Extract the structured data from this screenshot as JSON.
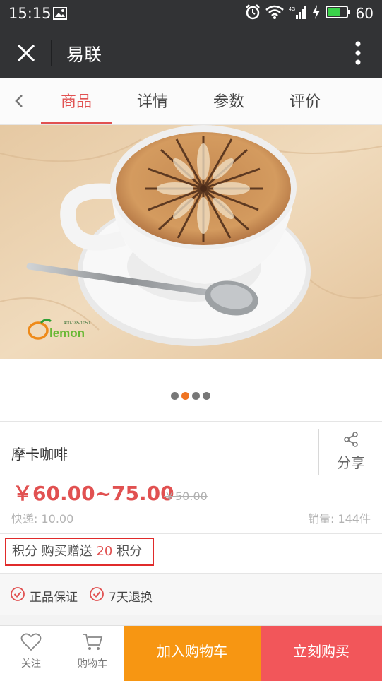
{
  "status_bar": {
    "time": "15:15",
    "battery": "60"
  },
  "title_bar": {
    "title": "易联"
  },
  "tabs": [
    {
      "label": "商品"
    },
    {
      "label": "详情"
    },
    {
      "label": "参数"
    },
    {
      "label": "评价"
    }
  ],
  "gallery": {
    "watermark_text": "lemon",
    "watermark_phone": "400-185-1050",
    "active_index": 1,
    "count": 4
  },
  "product": {
    "name": "摩卡咖啡",
    "share_label": "分享",
    "price": "￥60.00~75.00",
    "original_price": "￥50.00",
    "shipping": "快递: 10.00",
    "sales": "销量: 144件"
  },
  "points": {
    "label": "积分 购买赠送 ",
    "amount": "20",
    "suffix": " 积分"
  },
  "guarantees": [
    {
      "label": "正品保证"
    },
    {
      "label": "7天退换"
    }
  ],
  "bottom_bar": {
    "follow": "关注",
    "cart": "购物车",
    "add_to_cart": "加入购物车",
    "buy_now": "立刻购买"
  },
  "colors": {
    "accent": "#e15151",
    "orange": "#f79612",
    "buy": "#f2565a",
    "header": "#323335"
  }
}
